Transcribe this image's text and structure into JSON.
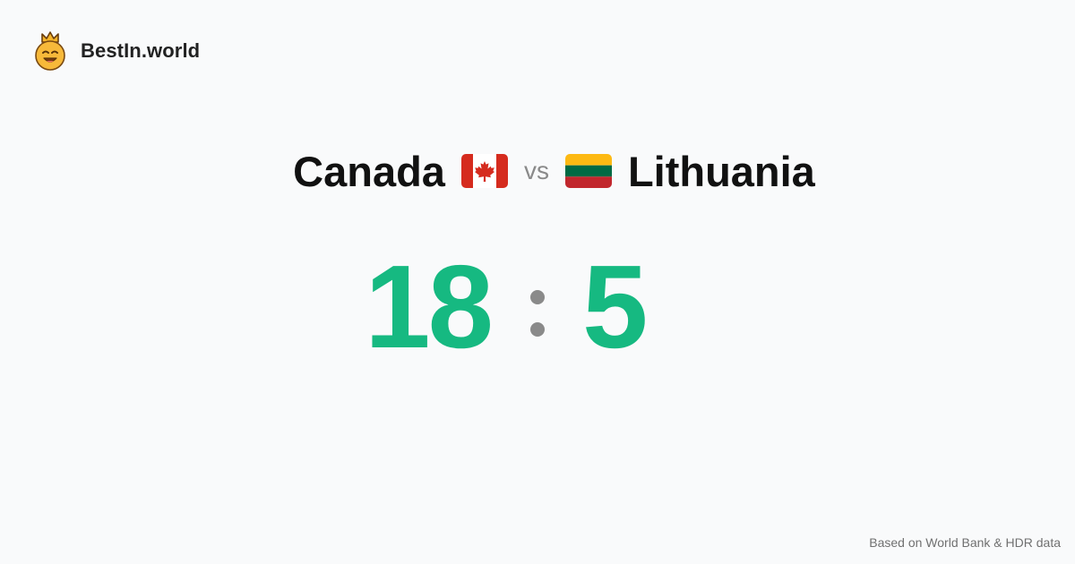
{
  "brand": {
    "logo_icon": "crown-smiley-icon",
    "name": "BestIn.world"
  },
  "comparison": {
    "left": {
      "country": "Canada",
      "flag_icon": "canada-flag-icon",
      "score": "18"
    },
    "vs_label": "vs",
    "right": {
      "country": "Lithuania",
      "flag_icon": "lithuania-flag-icon",
      "score": "5"
    },
    "separator": ":"
  },
  "footer": {
    "source_text": "Based on World Bank & HDR data"
  },
  "colors": {
    "score": "#16b981",
    "muted": "#8a8a8a",
    "background": "#f9fafb",
    "logo_face": "#f7b93a"
  }
}
